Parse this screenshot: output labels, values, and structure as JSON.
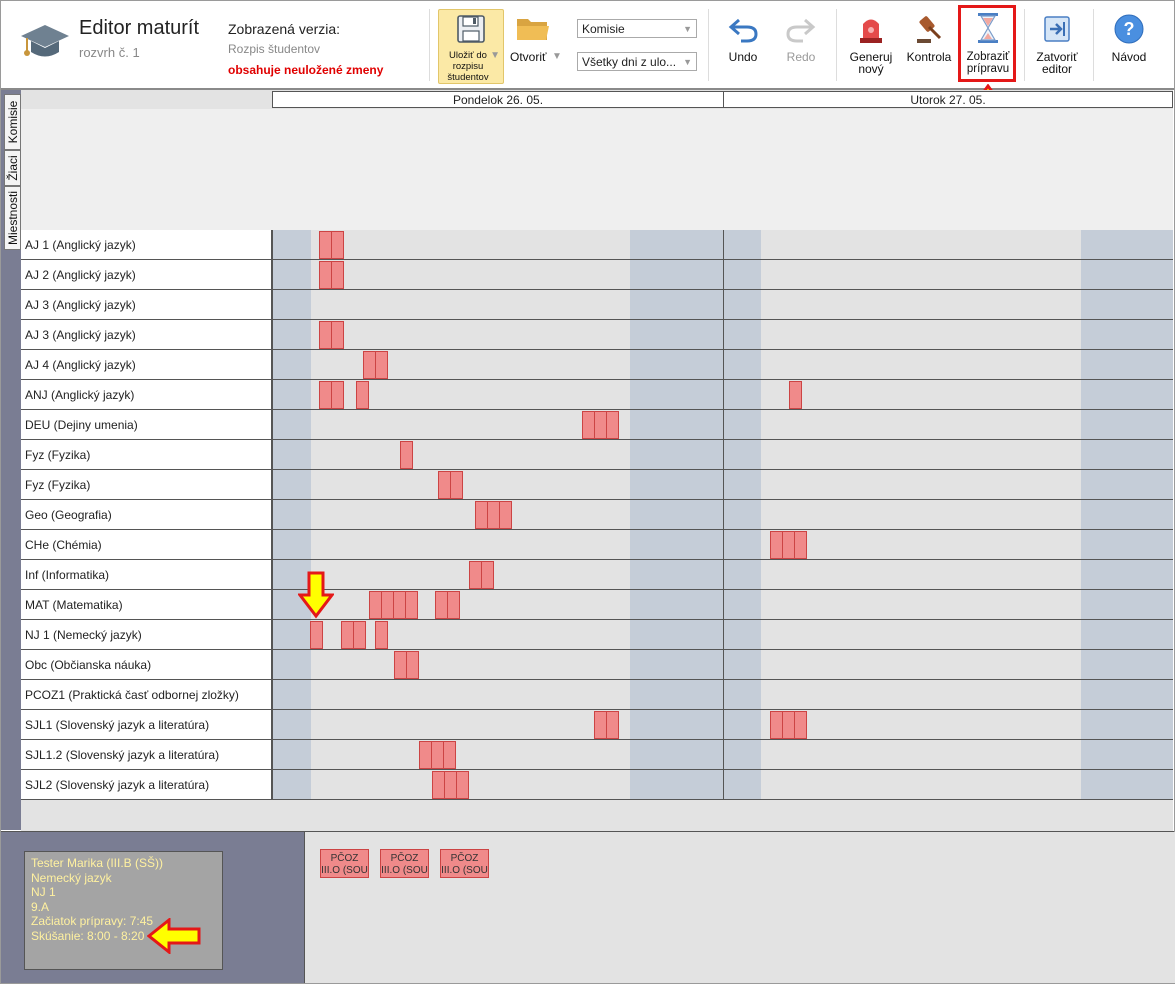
{
  "app": {
    "title": "Editor maturít",
    "subtitle": "rozvrh č. 1"
  },
  "version": {
    "heading": "Zobrazená verzia:",
    "name": "Rozpis študentov",
    "status": "obsahuje neuložené zmeny",
    "status_color": "#e00000"
  },
  "toolbar": {
    "save": "Uložiť do rozpisu študentov",
    "open": "Otvoriť",
    "filter1": "Komisie",
    "filter2": "Všetky dni z ulo...",
    "undo": "Undo",
    "redo": "Redo",
    "generate": "Generuj nový",
    "check": "Kontrola",
    "show_prep": "Zobraziť prípravu",
    "close": "Zatvoriť editor",
    "help": "Návod"
  },
  "side_tabs": [
    "Komisie",
    "Žiaci",
    "Miestnosti"
  ],
  "days": [
    "Pondelok 26. 05.",
    "Utorok 27. 05."
  ],
  "rows": [
    {
      "label": "AJ 1 (Anglický jazyk)",
      "blocks": [
        [
          319,
          2
        ]
      ]
    },
    {
      "label": "AJ 2 (Anglický jazyk)",
      "blocks": [
        [
          319,
          2
        ]
      ]
    },
    {
      "label": "AJ 3 (Anglický jazyk)",
      "blocks": []
    },
    {
      "label": "AJ 3 (Anglický jazyk)",
      "blocks": [
        [
          319,
          2
        ]
      ]
    },
    {
      "label": "AJ 4 (Anglický jazyk)",
      "blocks": [
        [
          363,
          2
        ]
      ]
    },
    {
      "label": "ANJ (Anglický jazyk)",
      "blocks": [
        [
          319,
          2
        ],
        [
          356,
          1
        ],
        [
          789,
          1
        ]
      ]
    },
    {
      "label": "DEU (Dejiny umenia)",
      "blocks": [
        [
          582,
          3
        ]
      ]
    },
    {
      "label": "Fyz (Fyzika)",
      "blocks": [
        [
          400,
          1
        ]
      ]
    },
    {
      "label": "Fyz (Fyzika)",
      "blocks": [
        [
          438,
          2
        ]
      ]
    },
    {
      "label": "Geo (Geografia)",
      "blocks": [
        [
          475,
          3
        ]
      ]
    },
    {
      "label": "CHe (Chémia)",
      "blocks": [
        [
          770,
          3
        ]
      ]
    },
    {
      "label": "Inf (Informatika)",
      "blocks": [
        [
          469,
          2
        ]
      ]
    },
    {
      "label": "MAT (Matematika)",
      "blocks": [
        [
          369,
          4
        ],
        [
          435,
          2
        ]
      ]
    },
    {
      "label": "NJ 1 (Nemecký jazyk)",
      "blocks": [
        [
          310,
          1
        ],
        [
          341,
          2
        ],
        [
          375,
          1
        ]
      ]
    },
    {
      "label": "Obc (Občianska náuka)",
      "blocks": [
        [
          394,
          2
        ]
      ]
    },
    {
      "label": "PCOZ1 (Praktická časť odbornej zložky)",
      "blocks": []
    },
    {
      "label": "SJL1 (Slovenský jazyk a literatúra)",
      "blocks": [
        [
          594,
          2
        ],
        [
          770,
          3
        ]
      ]
    },
    {
      "label": "SJL1.2 (Slovenský jazyk a literatúra)",
      "blocks": [
        [
          419,
          3
        ]
      ]
    },
    {
      "label": "SJL2 (Slovenský jazyk a literatúra)",
      "blocks": [
        [
          432,
          3
        ]
      ]
    }
  ],
  "info": {
    "student": "Tester Marika (III.B (SŠ))",
    "subject": "Nemecký jazyk",
    "committee": "NJ 1",
    "room": "9.A",
    "prep_start": "Začiatok prípravy: 7:45",
    "exam": "Skúšanie: 8:00 - 8:20"
  },
  "chips": [
    {
      "line1": "PČOZ",
      "line2": "III.O (SOU"
    },
    {
      "line1": "PČOZ",
      "line2": "III.O (SOU"
    },
    {
      "line1": "PČOZ",
      "line2": "III.O (SOU"
    }
  ],
  "colors": {
    "block": "#f08a8a",
    "shade": "#c5cdd8",
    "highlight": "#e41818",
    "arrow": "#ffff00"
  }
}
